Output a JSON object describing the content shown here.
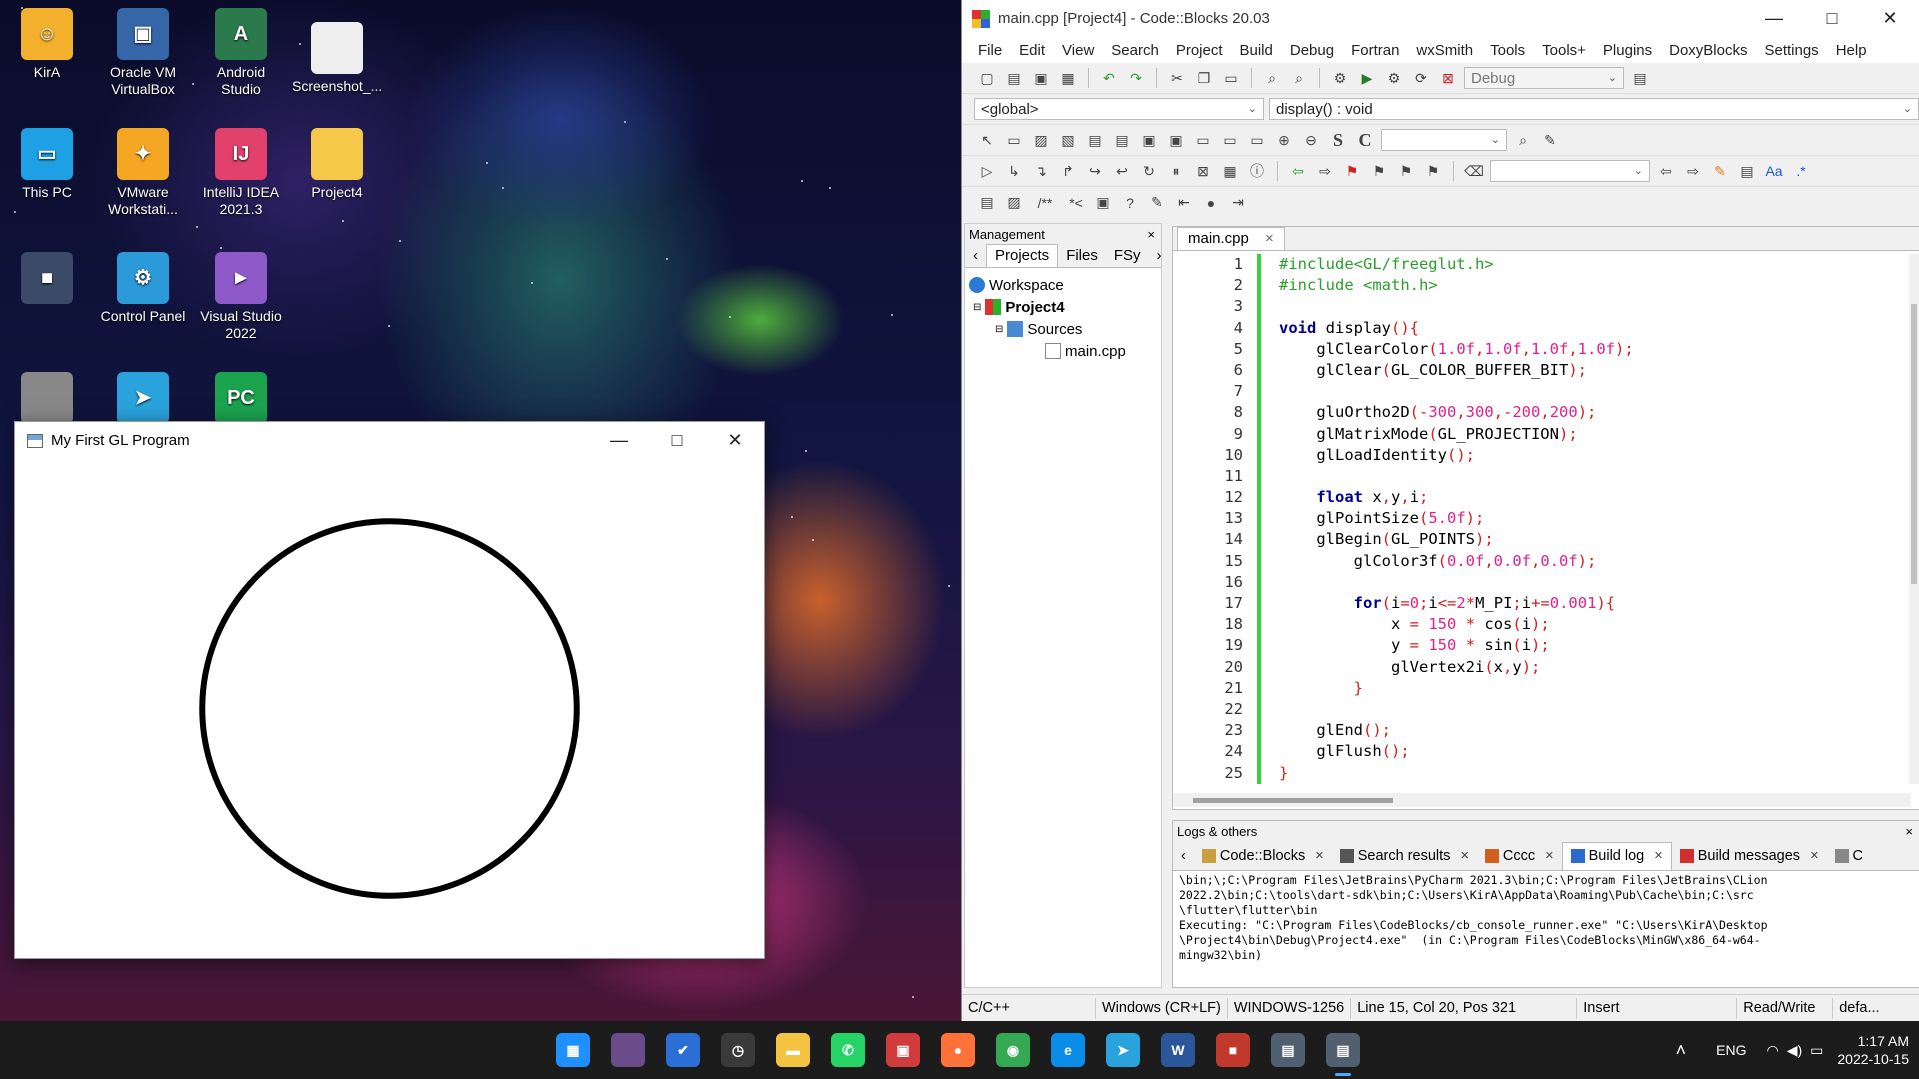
{
  "desktop": {
    "icons": [
      {
        "label": "KirA",
        "icon": "user-folder-icon",
        "color": "#f2b02c"
      },
      {
        "label": "Oracle VM VirtualBox",
        "icon": "virtualbox-icon",
        "color": "#3567a8"
      },
      {
        "label": "Android Studio",
        "icon": "android-studio-icon",
        "color": "#2b7a4b"
      },
      {
        "label": "Screenshot_...",
        "icon": "screenshot-file-icon",
        "color": "#eeeeee"
      },
      {
        "label": "This PC",
        "icon": "this-pc-icon",
        "color": "#1da1e4"
      },
      {
        "label": "VMware Workstati...",
        "icon": "vmware-icon",
        "color": "#f5a623"
      },
      {
        "label": "IntelliJ IDEA 2021.3",
        "icon": "intellij-icon",
        "color": "#e1416a"
      },
      {
        "label": "Project4",
        "icon": "folder-icon",
        "color": "#f5c84a"
      },
      {
        "label": "",
        "icon": "monitor-icon",
        "color": "#3b4a66"
      },
      {
        "label": "Control Panel",
        "icon": "control-panel-icon",
        "color": "#2c9ad8"
      },
      {
        "label": "Visual Studio 2022",
        "icon": "visual-studio-icon",
        "color": "#8e59c9"
      },
      {
        "label": "",
        "icon": "app-icon",
        "color": "#888888"
      },
      {
        "label": "",
        "icon": "telegram-icon",
        "color": "#2aa3dc"
      },
      {
        "label": "",
        "icon": "pycharm-icon",
        "color": "#1ba34e"
      }
    ],
    "icon_glyphs": [
      "☺",
      "▣",
      "A",
      "",
      "▭",
      "✦",
      "IJ",
      "",
      "■",
      "⚙",
      "►",
      "",
      "➤",
      "PC"
    ]
  },
  "gl_window": {
    "title": "My First GL Program",
    "minimize": "—",
    "maximize": "□",
    "close": "✕",
    "scene": {
      "shape": "circle",
      "ortho": [
        -300,
        300,
        -200,
        200
      ],
      "radius": 150,
      "point_size": 5,
      "color": "#000000",
      "background": "#ffffff"
    }
  },
  "codeblocks": {
    "title": "main.cpp [Project4] - Code::Blocks 20.03",
    "menu": [
      "File",
      "Edit",
      "View",
      "Search",
      "Project",
      "Build",
      "Debug",
      "Fortran",
      "wxSmith",
      "Tools",
      "Tools+",
      "Plugins",
      "DoxyBlocks",
      "Settings",
      "Help"
    ],
    "build_target": "Debug",
    "scope": "<global>",
    "function": "display() : void",
    "management": {
      "header": "Management",
      "close": "×",
      "tabs": [
        "Projects",
        "Files",
        "FSy"
      ],
      "tree": {
        "workspace": "Workspace",
        "project": "Project4",
        "folder": "Sources",
        "file": "main.cpp"
      }
    },
    "editor": {
      "tab": "main.cpp",
      "tab_close": "×",
      "lines": [
        [
          {
            "t": "#include<GL/freeglut.h>",
            "c": "pp"
          }
        ],
        [
          {
            "t": "#include <math.h>",
            "c": "pp"
          }
        ],
        [],
        [
          {
            "t": "void",
            "c": "kw"
          },
          {
            "t": " display"
          },
          {
            "t": "(){",
            "c": "op"
          }
        ],
        [
          {
            "t": "    glClearColor"
          },
          {
            "t": "(",
            "c": "op"
          },
          {
            "t": "1.0f",
            "c": "num"
          },
          {
            "t": ",",
            "c": "op"
          },
          {
            "t": "1.0f",
            "c": "num"
          },
          {
            "t": ",",
            "c": "op"
          },
          {
            "t": "1.0f",
            "c": "num"
          },
          {
            "t": ",",
            "c": "op"
          },
          {
            "t": "1.0f",
            "c": "num"
          },
          {
            "t": ");",
            "c": "op"
          }
        ],
        [
          {
            "t": "    glClear"
          },
          {
            "t": "(",
            "c": "op"
          },
          {
            "t": "GL_COLOR_BUFFER_BIT"
          },
          {
            "t": ");",
            "c": "op"
          }
        ],
        [],
        [
          {
            "t": "    gluOrtho2D"
          },
          {
            "t": "(-",
            "c": "op"
          },
          {
            "t": "300",
            "c": "num"
          },
          {
            "t": ",",
            "c": "op"
          },
          {
            "t": "300",
            "c": "num"
          },
          {
            "t": ",-",
            "c": "op"
          },
          {
            "t": "200",
            "c": "num"
          },
          {
            "t": ",",
            "c": "op"
          },
          {
            "t": "200",
            "c": "num"
          },
          {
            "t": ");",
            "c": "op"
          }
        ],
        [
          {
            "t": "    glMatrixMode"
          },
          {
            "t": "(",
            "c": "op"
          },
          {
            "t": "GL_PROJECTION"
          },
          {
            "t": ");",
            "c": "op"
          }
        ],
        [
          {
            "t": "    glLoadIdentity"
          },
          {
            "t": "();",
            "c": "op"
          }
        ],
        [],
        [
          {
            "t": "    "
          },
          {
            "t": "float",
            "c": "kw"
          },
          {
            "t": " x"
          },
          {
            "t": ",",
            "c": "op"
          },
          {
            "t": "y"
          },
          {
            "t": ",",
            "c": "op"
          },
          {
            "t": "i"
          },
          {
            "t": ";",
            "c": "op"
          }
        ],
        [
          {
            "t": "    glPointSize"
          },
          {
            "t": "(",
            "c": "op"
          },
          {
            "t": "5.0f",
            "c": "num"
          },
          {
            "t": ");",
            "c": "op"
          }
        ],
        [
          {
            "t": "    glBegin"
          },
          {
            "t": "(",
            "c": "op"
          },
          {
            "t": "GL_POINTS"
          },
          {
            "t": ");",
            "c": "op"
          }
        ],
        [
          {
            "t": "        glColor3f"
          },
          {
            "t": "(",
            "c": "op"
          },
          {
            "t": "0.0f",
            "c": "num"
          },
          {
            "t": ",",
            "c": "op"
          },
          {
            "t": "0.0f",
            "c": "num"
          },
          {
            "t": ",",
            "c": "op"
          },
          {
            "t": "0.0f",
            "c": "num"
          },
          {
            "t": ");",
            "c": "op"
          }
        ],
        [],
        [
          {
            "t": "        "
          },
          {
            "t": "for",
            "c": "kw"
          },
          {
            "t": "(",
            "c": "op"
          },
          {
            "t": "i"
          },
          {
            "t": "=",
            "c": "op"
          },
          {
            "t": "0",
            "c": "num"
          },
          {
            "t": ";",
            "c": "op"
          },
          {
            "t": "i"
          },
          {
            "t": "<=",
            "c": "op"
          },
          {
            "t": "2",
            "c": "num"
          },
          {
            "t": "*",
            "c": "op"
          },
          {
            "t": "M_PI"
          },
          {
            "t": ";",
            "c": "op"
          },
          {
            "t": "i"
          },
          {
            "t": "+=",
            "c": "op"
          },
          {
            "t": "0.001",
            "c": "num"
          },
          {
            "t": "){",
            "c": "op"
          }
        ],
        [
          {
            "t": "            x "
          },
          {
            "t": "=",
            "c": "op"
          },
          {
            "t": " "
          },
          {
            "t": "150",
            "c": "num"
          },
          {
            "t": " "
          },
          {
            "t": "*",
            "c": "op"
          },
          {
            "t": " cos"
          },
          {
            "t": "(",
            "c": "op"
          },
          {
            "t": "i"
          },
          {
            "t": ");",
            "c": "op"
          }
        ],
        [
          {
            "t": "            y "
          },
          {
            "t": "=",
            "c": "op"
          },
          {
            "t": " "
          },
          {
            "t": "150",
            "c": "num"
          },
          {
            "t": " "
          },
          {
            "t": "*",
            "c": "op"
          },
          {
            "t": " sin"
          },
          {
            "t": "(",
            "c": "op"
          },
          {
            "t": "i"
          },
          {
            "t": ");",
            "c": "op"
          }
        ],
        [
          {
            "t": "            glVertex2i"
          },
          {
            "t": "(",
            "c": "op"
          },
          {
            "t": "x"
          },
          {
            "t": ",",
            "c": "op"
          },
          {
            "t": "y"
          },
          {
            "t": ");",
            "c": "op"
          }
        ],
        [
          {
            "t": "        "
          },
          {
            "t": "}",
            "c": "op"
          }
        ],
        [],
        [
          {
            "t": "    glEnd"
          },
          {
            "t": "();",
            "c": "op"
          }
        ],
        [
          {
            "t": "    glFlush"
          },
          {
            "t": "();",
            "c": "op"
          }
        ],
        [
          {
            "t": "}",
            "c": "op"
          }
        ]
      ]
    },
    "logs": {
      "header": "Logs & others",
      "close": "×",
      "tabs": [
        "Code::Blocks",
        "Search results",
        "Cccc",
        "Build log",
        "Build messages",
        "C"
      ],
      "active_tab": "Build log",
      "text": "\\bin;\\;C:\\Program Files\\JetBrains\\PyCharm 2021.3\\bin;C:\\Program Files\\JetBrains\\CLion\n2022.2\\bin;C:\\tools\\dart-sdk\\bin;C:\\Users\\KirA\\AppData\\Roaming\\Pub\\Cache\\bin;C:\\src\n\\flutter\\flutter\\bin\nExecuting: \"C:\\Program Files\\CodeBlocks/cb_console_runner.exe\" \"C:\\Users\\KirA\\Desktop\n\\Project4\\bin\\Debug\\Project4.exe\"  (in C:\\Program Files\\CodeBlocks\\MinGW\\x86_64-w64-\nmingw32\\bin)"
    },
    "status": {
      "lang": "C/C++",
      "eol": "Windows (CR+LF)",
      "encoding": "WINDOWS-1256",
      "position": "Line 15, Col 20, Pos 321",
      "mode": "Insert",
      "access": "Read/Write",
      "default": "defa..."
    }
  },
  "taskbar": {
    "icons": [
      {
        "icon": "windows-start-icon",
        "color": "#1e90ff",
        "glyph": "▦"
      },
      {
        "icon": "app-icon",
        "color": "#6a4c8a",
        "glyph": ""
      },
      {
        "icon": "todo-icon",
        "color": "#2b6fd6",
        "glyph": "✔"
      },
      {
        "icon": "clock-app-icon",
        "color": "#3a3a3a",
        "glyph": "◷"
      },
      {
        "icon": "file-explorer-icon",
        "color": "#f5c342",
        "glyph": "▬"
      },
      {
        "icon": "whatsapp-icon",
        "color": "#25d366",
        "glyph": "✆"
      },
      {
        "icon": "lock-app-icon",
        "color": "#d23b3b",
        "glyph": "▣"
      },
      {
        "icon": "firefox-icon",
        "color": "#ff7139",
        "glyph": "●"
      },
      {
        "icon": "chrome-icon",
        "color": "#34a853",
        "glyph": "◉"
      },
      {
        "icon": "edge-icon",
        "color": "#0c8ce9",
        "glyph": "e"
      },
      {
        "icon": "telegram-icon",
        "color": "#2aa3dc",
        "glyph": "➤"
      },
      {
        "icon": "word-icon",
        "color": "#2b579a",
        "glyph": "W"
      },
      {
        "icon": "codeblocks-icon",
        "color": "#c0392b",
        "glyph": "■"
      },
      {
        "icon": "window-app-icon",
        "color": "#506070",
        "glyph": "▤"
      },
      {
        "icon": "gl-window-icon",
        "color": "#506070",
        "glyph": "▤"
      }
    ],
    "tray": {
      "chevron": "˄",
      "lang": "ENG",
      "time": "1:17 AM",
      "date": "2022-10-15"
    }
  }
}
